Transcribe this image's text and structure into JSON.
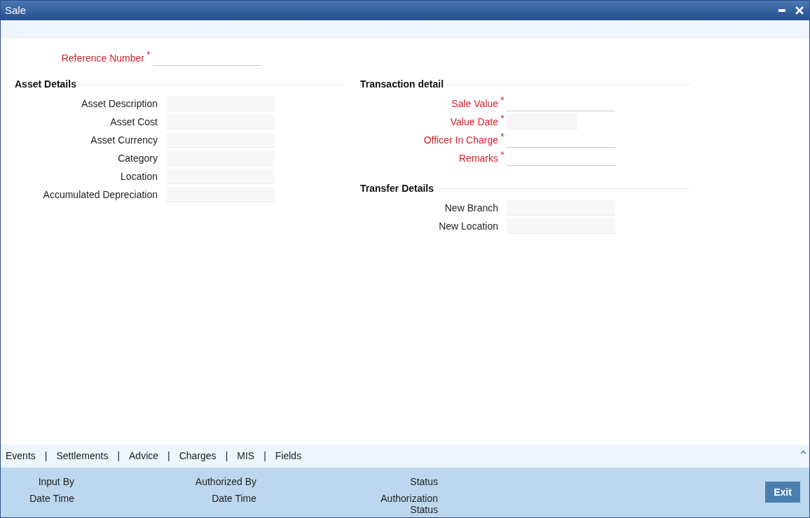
{
  "window": {
    "title": "Sale"
  },
  "reference": {
    "label": "Reference Number",
    "required": true,
    "kind": "input"
  },
  "sections": [
    {
      "title": "Asset Details",
      "fields": [
        {
          "label": "Asset Description",
          "required": false,
          "kind": "readonly"
        },
        {
          "label": "Asset Cost",
          "required": false,
          "kind": "readonly"
        },
        {
          "label": "Asset Currency",
          "required": false,
          "kind": "readonly"
        },
        {
          "label": "Category",
          "required": false,
          "kind": "readonly"
        },
        {
          "label": "Location",
          "required": false,
          "kind": "readonly"
        },
        {
          "label": "Accumulated Depreciation",
          "required": false,
          "kind": "readonly"
        }
      ]
    },
    {
      "title": "Transaction detail",
      "fields": [
        {
          "label": "Sale Value",
          "required": true,
          "kind": "input"
        },
        {
          "label": "Value Date",
          "required": true,
          "kind": "date"
        },
        {
          "label": "Officer In Charge",
          "required": true,
          "kind": "input"
        },
        {
          "label": "Remarks",
          "required": true,
          "kind": "input"
        }
      ]
    },
    {
      "title": "Transfer Details",
      "fields": [
        {
          "label": "New Branch",
          "required": false,
          "kind": "readonly"
        },
        {
          "label": "New Location",
          "required": false,
          "kind": "readonly"
        }
      ]
    }
  ],
  "required_mark": "*",
  "tabs": [
    "Events",
    "Settlements",
    "Advice",
    "Charges",
    "MIS",
    "Fields"
  ],
  "separator": "|",
  "audit": [
    {
      "label": "Input By"
    },
    {
      "label": "Authorized By"
    },
    {
      "label": "Status"
    },
    {
      "label": "Date Time"
    },
    {
      "label": "Date Time"
    },
    {
      "label": "Authorization Status"
    }
  ],
  "exit_button": "Exit"
}
